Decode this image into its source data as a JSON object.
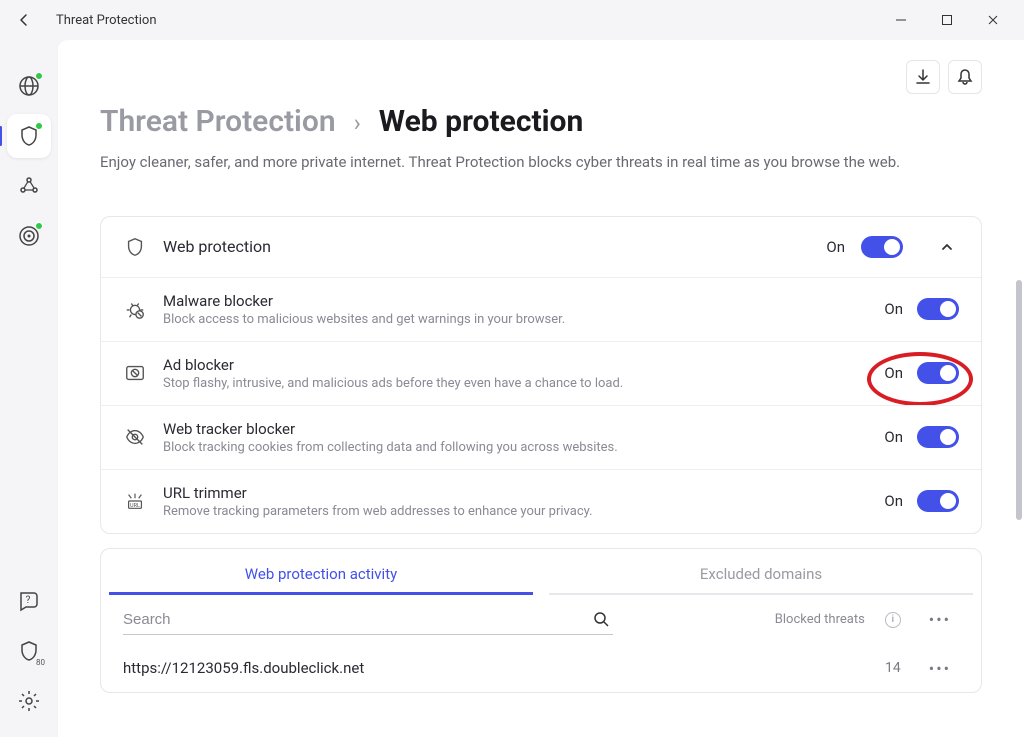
{
  "window": {
    "title": "Threat Protection"
  },
  "sidebar": {
    "badge_80": "80"
  },
  "header": {
    "breadcrumb_root": "Threat Protection",
    "breadcrumb_current": "Web protection",
    "description": "Enjoy cleaner, safer, and more private internet. Threat Protection blocks cyber threats in real time as you browse the web."
  },
  "web_protection": {
    "title": "Web protection",
    "state": "On"
  },
  "features": {
    "malware": {
      "title": "Malware blocker",
      "desc": "Block access to malicious websites and get warnings in your browser.",
      "state": "On"
    },
    "ads": {
      "title": "Ad blocker",
      "desc": "Stop flashy, intrusive, and malicious ads before they even have a chance to load.",
      "state": "On"
    },
    "tracker": {
      "title": "Web tracker blocker",
      "desc": "Block tracking cookies from collecting data and following you across websites.",
      "state": "On"
    },
    "url": {
      "title": "URL trimmer",
      "desc": "Remove tracking parameters from web addresses to enhance your privacy.",
      "state": "On"
    }
  },
  "activity": {
    "tab_activity": "Web protection activity",
    "tab_excluded": "Excluded domains",
    "search_placeholder": "Search",
    "blocked_label": "Blocked threats",
    "entries": [
      {
        "url": "https://12123059.fls.doubleclick.net",
        "count": "14"
      }
    ]
  }
}
